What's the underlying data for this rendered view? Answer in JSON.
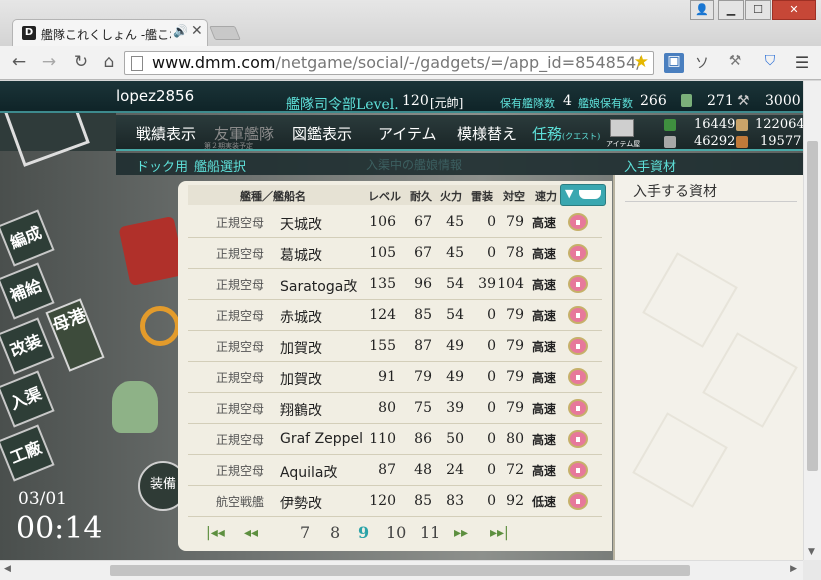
{
  "browser": {
    "tab_title": "艦隊これくしょん -艦これ",
    "url_host": "www.dmm.com",
    "url_path": "/netgame/social/-/gadgets/=/app_id=854854/"
  },
  "game": {
    "player_name": "lopez2856",
    "hq_label": "艦隊司令部Level.",
    "hq_level": "120",
    "hq_rank": "[元帥]",
    "ships_label": "保有艦隊数",
    "ships_count": "4",
    "equip_label": "艦娘保有数",
    "equip_count": "266",
    "buckets": "271",
    "dev_mats": "3000",
    "menu": {
      "record": "戦績表示",
      "friendly": "友軍艦隊",
      "friendly_sub": "第２期実装予定",
      "library": "図鑑表示",
      "items": "アイテム",
      "deco": "模様替え",
      "quest": "任務",
      "quest_sub": "(クエスト)",
      "item_store": "アイテム屋"
    },
    "resources": {
      "fuel": "16449",
      "ammo": "122064",
      "steel": "46292",
      "bauxite": "19577"
    },
    "subbar": {
      "dock": "ドック用",
      "ship_select": "艦船選択",
      "ghost": "入渠中の艦娘情報",
      "materials": "入手資材"
    },
    "side_menu": {
      "fleet": "編成",
      "supply": "補給",
      "remodel": "改装",
      "repair": "入渠",
      "arsenal": "工廠",
      "port": "母港",
      "equip_btn": "装備"
    },
    "clock": {
      "date": "03/01",
      "time": "00:14"
    }
  },
  "ship_list": {
    "headers": {
      "type_name": "艦種／艦船名",
      "level": "レベル",
      "hp": "耐久",
      "firepower": "火力",
      "torpedo": "雷装",
      "aa": "対空",
      "speed": "速力"
    },
    "rows": [
      {
        "type": "正規空母",
        "name": "天城改",
        "lv": "106",
        "hp": "67",
        "fp": "45",
        "tp": "0",
        "aa": "79",
        "spd": "高速"
      },
      {
        "type": "正規空母",
        "name": "葛城改",
        "lv": "105",
        "hp": "67",
        "fp": "45",
        "tp": "0",
        "aa": "78",
        "spd": "高速"
      },
      {
        "type": "正規空母",
        "name": "Saratoga改",
        "lv": "135",
        "hp": "96",
        "fp": "54",
        "tp": "39",
        "aa": "104",
        "spd": "高速"
      },
      {
        "type": "正規空母",
        "name": "赤城改",
        "lv": "124",
        "hp": "85",
        "fp": "54",
        "tp": "0",
        "aa": "79",
        "spd": "高速"
      },
      {
        "type": "正規空母",
        "name": "加賀改",
        "lv": "155",
        "hp": "87",
        "fp": "49",
        "tp": "0",
        "aa": "79",
        "spd": "高速"
      },
      {
        "type": "正規空母",
        "name": "加賀改",
        "lv": "91",
        "hp": "79",
        "fp": "49",
        "tp": "0",
        "aa": "79",
        "spd": "高速"
      },
      {
        "type": "正規空母",
        "name": "翔鶴改",
        "lv": "80",
        "hp": "75",
        "fp": "39",
        "tp": "0",
        "aa": "79",
        "spd": "高速"
      },
      {
        "type": "正規空母",
        "name": "Graf Zeppel",
        "lv": "110",
        "hp": "86",
        "fp": "50",
        "tp": "0",
        "aa": "80",
        "spd": "高速"
      },
      {
        "type": "正規空母",
        "name": "Aquila改",
        "lv": "87",
        "hp": "48",
        "fp": "24",
        "tp": "0",
        "aa": "72",
        "spd": "高速"
      },
      {
        "type": "航空戦艦",
        "name": "伊勢改",
        "lv": "120",
        "hp": "85",
        "fp": "83",
        "tp": "0",
        "aa": "92",
        "spd": "低速"
      }
    ],
    "pages": [
      "7",
      "8",
      "9",
      "10",
      "11"
    ],
    "current_page": "9"
  },
  "materials_panel": {
    "title": "入手する資材"
  },
  "colors": {
    "accent_cyan": "#5ee0d9",
    "sort_button": "#3aa7b0",
    "close_button": "#c64737"
  }
}
